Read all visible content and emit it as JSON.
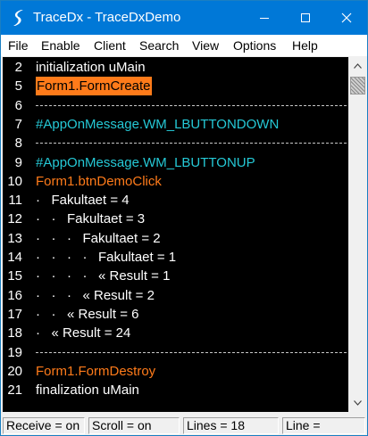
{
  "window": {
    "title": "TraceDx - TraceDxDemo",
    "accent_color": "#0078d7",
    "icon": "tracedx-logo-icon"
  },
  "menu": [
    "File",
    "Enable",
    "Client",
    "Search",
    "View",
    "Options",
    "Help"
  ],
  "lines": [
    {
      "num": "2",
      "text": "initialization uMain",
      "color": "#ffffff"
    },
    {
      "num": "5",
      "text": "Form1.FormCreate",
      "color": "#000000",
      "highlight": "#ff7b1a"
    },
    {
      "num": "6",
      "separator": true
    },
    {
      "num": "7",
      "text": "#AppOnMessage.WM_LBUTTONDOWN",
      "color": "#25c9d6"
    },
    {
      "num": "8",
      "separator": true
    },
    {
      "num": "9",
      "text": "#AppOnMessage.WM_LBUTTONUP",
      "color": "#25c9d6"
    },
    {
      "num": "10",
      "text": "Form1.btnDemoClick",
      "color": "#ff7b1a"
    },
    {
      "num": "11",
      "text": "·   Fakultaet = 4",
      "color": "#ffffff"
    },
    {
      "num": "12",
      "text": "·   ·   Fakultaet = 3",
      "color": "#ffffff"
    },
    {
      "num": "13",
      "text": "·   ·   ·   Fakultaet = 2",
      "color": "#ffffff"
    },
    {
      "num": "14",
      "text": "·   ·   ·   ·   Fakultaet = 1",
      "color": "#ffffff"
    },
    {
      "num": "15",
      "text": "·   ·   ·   ·   « Result = 1",
      "color": "#ffffff"
    },
    {
      "num": "16",
      "text": "·   ·   ·   « Result = 2",
      "color": "#ffffff"
    },
    {
      "num": "17",
      "text": "·   ·   « Result = 6",
      "color": "#ffffff"
    },
    {
      "num": "18",
      "text": "·   « Result = 24",
      "color": "#ffffff"
    },
    {
      "num": "19",
      "separator": true
    },
    {
      "num": "20",
      "text": "Form1.FormDestroy",
      "color": "#ff7b1a"
    },
    {
      "num": "21",
      "text": "finalization uMain",
      "color": "#ffffff"
    }
  ],
  "status": {
    "receive": "Receive = on",
    "scroll": "Scroll = on",
    "lines": "Lines = 18",
    "line": "Line ="
  }
}
